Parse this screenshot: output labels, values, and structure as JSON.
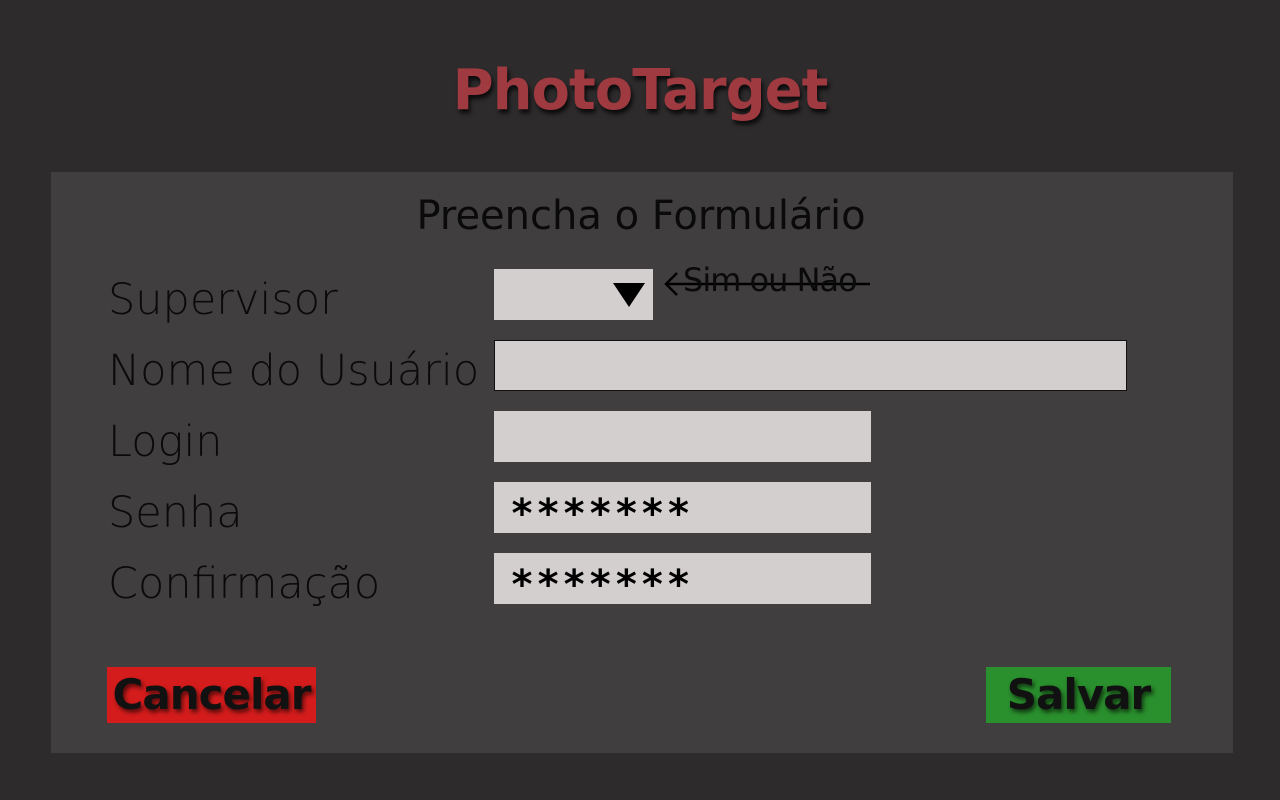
{
  "app": {
    "title": "PhotoTarget",
    "accent": "#9e3a40"
  },
  "form": {
    "title": "Preencha o Formulário",
    "fields": {
      "supervisor": {
        "label": "Supervisor",
        "value": "",
        "hint": "Sim ou Não"
      },
      "username": {
        "label": "Nome do Usuário",
        "value": ""
      },
      "login": {
        "label": "Login",
        "value": ""
      },
      "password": {
        "label": "Senha",
        "value": "*******"
      },
      "confirm": {
        "label": "Confirmação",
        "value": "*******"
      }
    }
  },
  "actions": {
    "cancel_label": "Cancelar",
    "cancel_color": "#d41c1c",
    "save_label": "Salvar",
    "save_color": "#2a8f2d"
  },
  "icons": {
    "dropdown": "triangle-down-icon",
    "hint_arrow": "arrow-left-icon"
  }
}
